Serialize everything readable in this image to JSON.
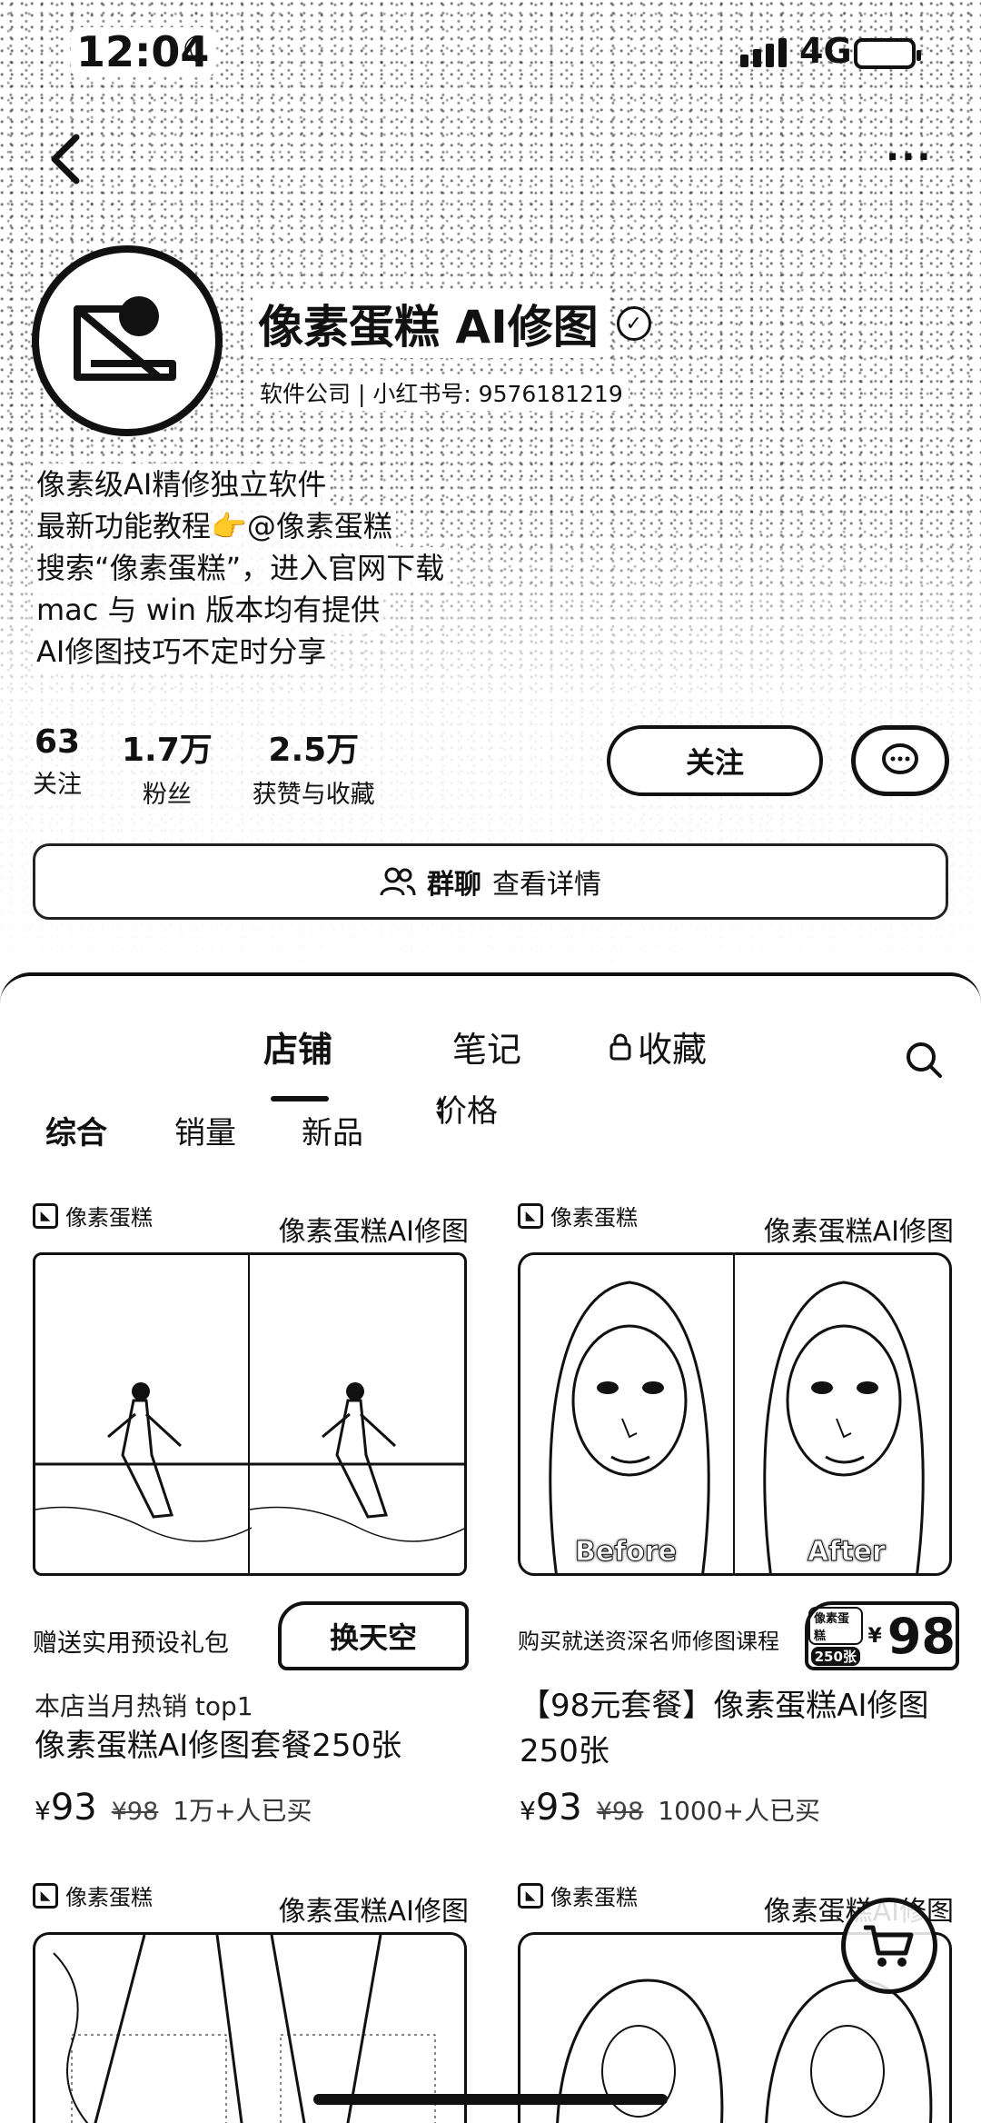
{
  "status": {
    "time": "12:04",
    "network": "4G"
  },
  "profile": {
    "name": "像素蛋糕 AI修图",
    "meta": "软件公司 | 小红书号: 9576181219",
    "bio": [
      "像素级AI精修独立软件",
      "最新功能教程👉@像素蛋糕",
      "搜索“像素蛋糕”，进入官网下载",
      "mac 与 win 版本均有提供",
      "AI修图技巧不定时分享"
    ],
    "stats": [
      {
        "num": "63",
        "label": "关注"
      },
      {
        "num": "1.7万",
        "label": "粉丝"
      },
      {
        "num": "2.5万",
        "label": "获赞与收藏"
      }
    ],
    "follow_label": "关注",
    "group_chat": "群聊",
    "group_detail": "查看详情"
  },
  "tabs": [
    "店铺",
    "笔记",
    "收藏"
  ],
  "filters": [
    "综合",
    "销量",
    "新品",
    "价格"
  ],
  "products": [
    {
      "brand": "像素蛋糕",
      "brand_right": "像素蛋糕AI修图",
      "promo_text": "赠送实用预设礼包",
      "promo_badge": "换天空",
      "sub": "本店当月热销 top1",
      "title": "像素蛋糕AI修图套餐250张",
      "price_symbol": "¥",
      "price": "93",
      "original": "¥98",
      "sold": "1万+人已买"
    },
    {
      "brand": "像素蛋糕",
      "brand_right": "像素蛋糕AI修图",
      "caption_before": "Before",
      "caption_after": "After",
      "promo_text": "购买就送资深名师修图课程",
      "badge_top": "像素蛋糕",
      "badge_count": "250张",
      "badge_price_symbol": "¥",
      "badge_price": "98",
      "title": "【98元套餐】像素蛋糕AI修图250张",
      "price_symbol": "¥",
      "price": "93",
      "original": "¥98",
      "sold": "1000+人已买"
    },
    {
      "brand": "像素蛋糕",
      "brand_right": "像素蛋糕AI修图"
    },
    {
      "brand": "像素蛋糕",
      "brand_right": "像素蛋糕AI修图"
    }
  ]
}
